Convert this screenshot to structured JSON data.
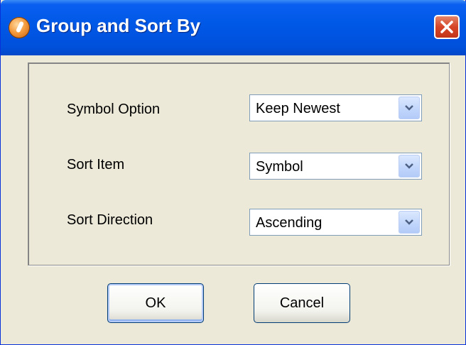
{
  "window": {
    "title": "Group and Sort By",
    "icon": "app-icon",
    "close_icon": "close-icon"
  },
  "fields": [
    {
      "label": "Symbol Option",
      "value": "Keep Newest"
    },
    {
      "label": "Sort Item",
      "value": "Symbol"
    },
    {
      "label": "Sort Direction",
      "value": "Ascending"
    }
  ],
  "buttons": {
    "ok": "OK",
    "cancel": "Cancel"
  },
  "colors": {
    "titlebar": "#0058e6",
    "close_button": "#d64527",
    "dialog_background": "#ece9d8",
    "combo_border": "#7f9db9"
  }
}
